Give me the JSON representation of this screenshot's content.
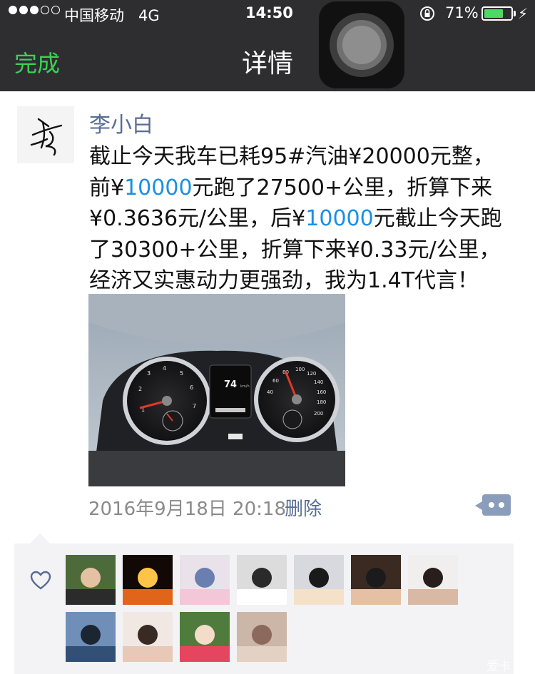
{
  "status_bar": {
    "carrier": "中国移动",
    "network": "4G",
    "time": "14:50",
    "battery_percent": "71%",
    "battery_level": 0.71,
    "signal_bars_filled": 3,
    "signal_bars_total": 5
  },
  "nav": {
    "done_label": "完成",
    "title": "详情"
  },
  "post": {
    "author": "李小白",
    "lines": [
      {
        "text": "截止今天我车已耗95#汽油¥20000元整，"
      },
      {
        "pre": "前¥",
        "link": "10000",
        "post": "元跑了27500+公里，折算下来"
      },
      {
        "pre": "¥0.3636元/公里，后¥",
        "link": "10000",
        "post": "元截止今天跑"
      },
      {
        "text": "了30300+公里，折算下来¥0.33元/公里，"
      },
      {
        "text": "经济又实惠动力更强劲，我为1.4T代言！"
      }
    ],
    "photo": {
      "trip_display": "74",
      "trip_unit": "km/h"
    },
    "timestamp": "2016年9月18日 20:18",
    "delete_label": "删除"
  },
  "likes": {
    "avatars": [
      {
        "name": "like-avatar-1"
      },
      {
        "name": "like-avatar-2"
      },
      {
        "name": "like-avatar-3"
      },
      {
        "name": "like-avatar-4"
      },
      {
        "name": "like-avatar-5"
      },
      {
        "name": "like-avatar-6"
      },
      {
        "name": "like-avatar-7"
      },
      {
        "name": "like-avatar-8"
      },
      {
        "name": "like-avatar-9"
      },
      {
        "name": "like-avatar-10"
      },
      {
        "name": "like-avatar-11"
      }
    ]
  },
  "watermark": "爱卡"
}
